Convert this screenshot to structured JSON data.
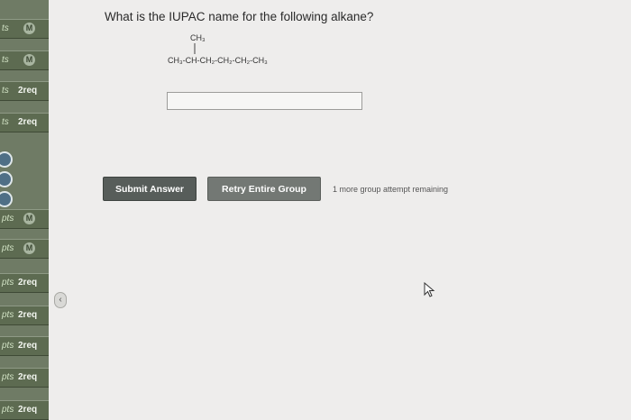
{
  "question": {
    "text": "What is the IUPAC name for the following alkane?"
  },
  "molecule": {
    "substituent": "CH₃",
    "chain": "CH₃-CH-CH₂-CH₂-CH₂-CH₃"
  },
  "answer": {
    "value": ""
  },
  "buttons": {
    "submit": "Submit Answer",
    "retry": "Retry Entire Group"
  },
  "attempts_note": "1 more group attempt remaining",
  "sidebar": {
    "items": [
      {
        "pts": "ts",
        "tag": "M"
      },
      {
        "pts": "ts",
        "tag": "M"
      },
      {
        "pts": "ts",
        "tag": "2req"
      },
      {
        "pts": "ts",
        "tag": "2req"
      },
      {
        "pts": "pts",
        "tag": "M"
      },
      {
        "pts": "pts",
        "tag": "M"
      },
      {
        "pts": "pts",
        "tag": "2req"
      },
      {
        "pts": "pts",
        "tag": "2req"
      },
      {
        "pts": "pts",
        "tag": "2req"
      },
      {
        "pts": "pts",
        "tag": "2req"
      },
      {
        "pts": "pts",
        "tag": "2req"
      }
    ]
  },
  "colors": {
    "sidebar": "#6f7b65",
    "submit": "#575d5a",
    "retry": "#737874",
    "background": "#eeedec"
  }
}
